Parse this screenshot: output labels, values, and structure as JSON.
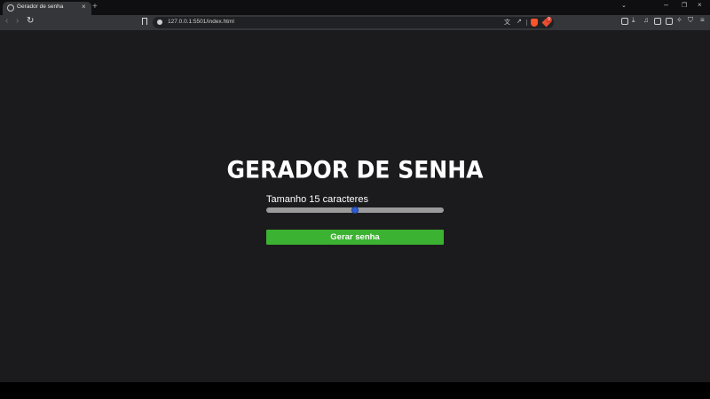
{
  "browser": {
    "tab": {
      "title": "Gerador de senha",
      "close": "×"
    },
    "new_tab": "+",
    "tab_list": "⌄",
    "window_controls": {
      "minimize": "–",
      "maximize": "❐",
      "close": "×"
    },
    "nav": {
      "back": "‹",
      "forward": "›",
      "reload": "↻"
    },
    "url": "127.0.0.1:5501/index.html",
    "rewards_badge": "9",
    "colors": {
      "brave_orange": "#fb542b"
    }
  },
  "page": {
    "title": "GERADOR DE SENHA",
    "slider": {
      "label": "Tamanho 15 caracteres",
      "value": 15,
      "fraction": 0.5
    },
    "generate_button": "Gerar senha",
    "colors": {
      "button": "#3bb231",
      "background": "#1b1b1d",
      "slider_thumb": "#2d5fd3"
    }
  }
}
